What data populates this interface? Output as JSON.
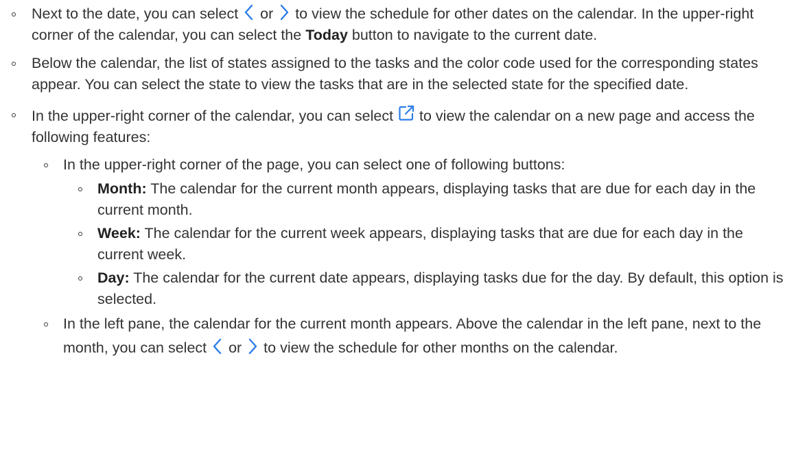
{
  "colors": {
    "text": "#333333",
    "icon_accent": "#2b7de9"
  },
  "items": [
    {
      "pre": "Next to the date, you can select ",
      "icon_left": "chevron-left-icon",
      "or": " or ",
      "icon_right": "chevron-right-icon",
      "mid": " to view the schedule for other dates on the calendar. In the upper-right corner of the calendar, you can select the ",
      "bold": "Today",
      "post": " button to navigate to the current date."
    },
    {
      "text": "Below the calendar, the list of states assigned to the tasks and the color code used for the corresponding states appear. You can select the state to view the tasks that are in the selected state for the specified date."
    },
    {
      "pre": "In the upper-right corner of the calendar, you can select ",
      "icon": "external-link-icon",
      "post": " to view the calendar on a new page and access the following features:",
      "sub": [
        {
          "text": "In the upper-right corner of the page, you can select one of following buttons:",
          "sub": [
            {
              "bold": "Month:",
              "text": " The calendar for the current month appears, displaying tasks that are due for each day in the current month."
            },
            {
              "bold": "Week:",
              "text": " The calendar for the current week appears, displaying tasks that are due for each day in the current week."
            },
            {
              "bold": "Day:",
              "text": " The calendar for the current date appears, displaying tasks due for the day. By default, this option is selected."
            }
          ]
        },
        {
          "pre": "In the left pane, the calendar for the current month appears. Above the calendar in the left pane, next to the month, you can select ",
          "icon_left": "chevron-left-icon",
          "or": " or ",
          "icon_right": "chevron-right-icon",
          "post": " to view the schedule for other months on the calendar."
        }
      ]
    }
  ]
}
